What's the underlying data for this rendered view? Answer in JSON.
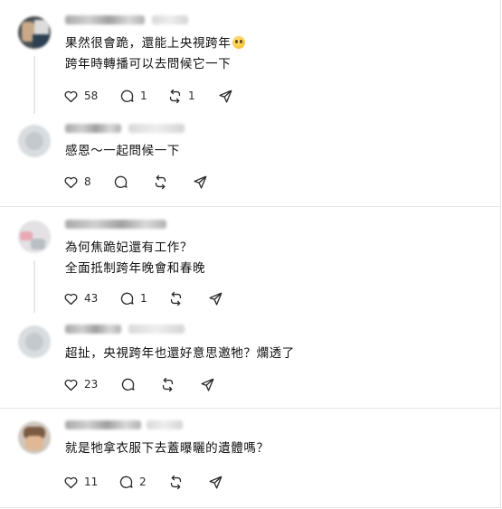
{
  "threads": [
    {
      "post": {
        "lines": [
          "果然很會跪，還能上央視跨年",
          "跨年時轉播可以去問候它一下"
        ],
        "emoji": "face-with-rolling-eyes",
        "likes": "58",
        "replies": "1",
        "reposts": "1"
      },
      "reply": {
        "lines": [
          "感恩～一起問候一下"
        ],
        "likes": "8",
        "replies": "",
        "reposts": ""
      }
    },
    {
      "post": {
        "lines": [
          "為何焦跪妃還有工作？",
          "全面抵制跨年晚會和春晚"
        ],
        "likes": "43",
        "replies": "1",
        "reposts": ""
      },
      "reply": {
        "lines": [
          "超扯，央視跨年也還好意思邀牠？爛透了"
        ],
        "likes": "23",
        "replies": "",
        "reposts": ""
      }
    },
    {
      "post": {
        "lines": [
          "就是牠拿衣服下去蓋曝曬的遺體嗎？"
        ],
        "likes": "11",
        "replies": "2",
        "reposts": ""
      }
    }
  ],
  "icons": {
    "like": "heart-icon",
    "reply": "comment-icon",
    "repost": "repost-icon",
    "share": "send-icon"
  },
  "colors": {
    "text": "#101010",
    "icon": "#2b2b2b",
    "divider": "#e6e6e6"
  }
}
